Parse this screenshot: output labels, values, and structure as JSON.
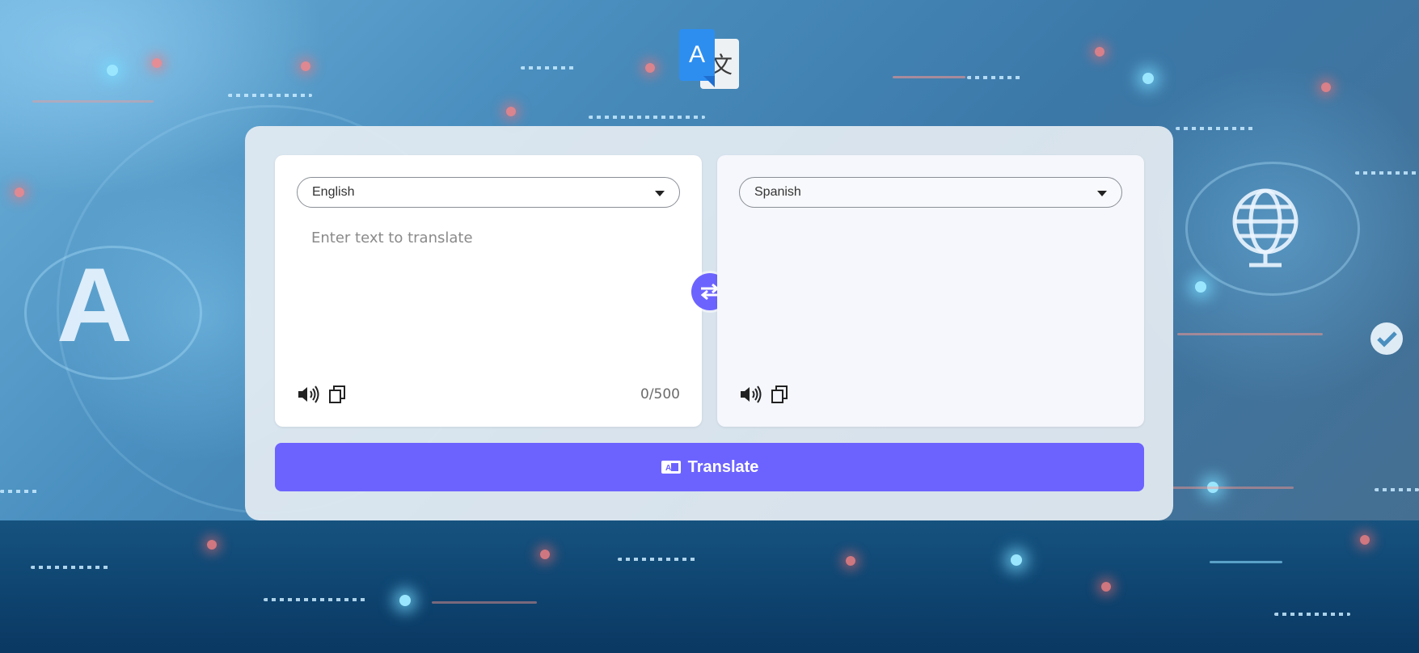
{
  "app": {
    "logo_front_letter": "A",
    "logo_back_glyph": "文"
  },
  "source": {
    "language": "English",
    "placeholder": "Enter text to translate",
    "text": "",
    "counter": "0/500"
  },
  "target": {
    "language": "Spanish",
    "text": ""
  },
  "translate_button": {
    "label": "Translate"
  },
  "background": {
    "letter": "A"
  },
  "icons": {
    "speaker": "speaker-icon",
    "copy": "copy-icon",
    "swap": "swap-arrows-icon",
    "translate": "translate-icon"
  },
  "colors": {
    "accent": "#6c63ff",
    "logo_blue": "#2d8ef0"
  }
}
